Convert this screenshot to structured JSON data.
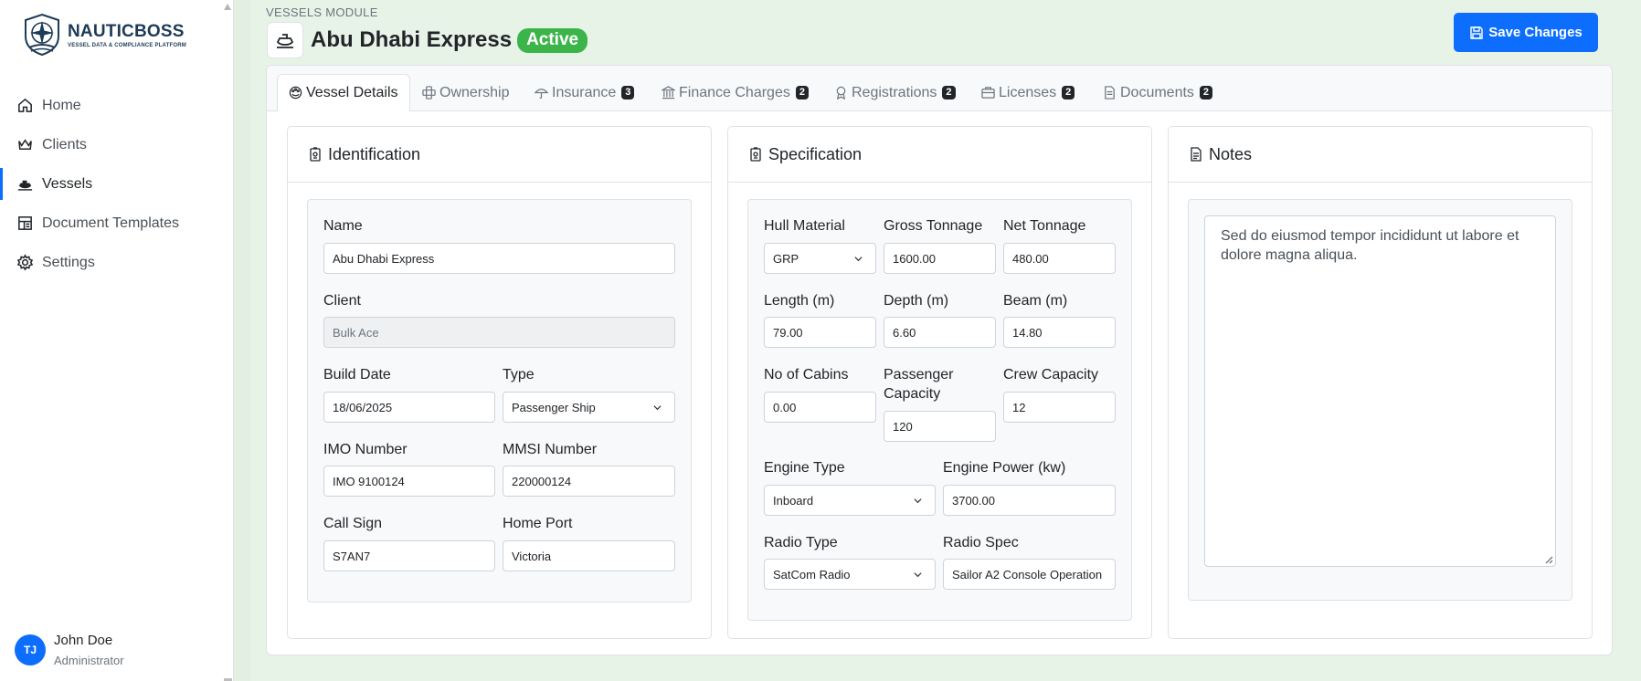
{
  "brand": {
    "name_part1": "NAUTIC",
    "name_part2": "BOSS",
    "tagline": "VESSEL DATA & COMPLIANCE PLATFORM"
  },
  "nav": {
    "items": [
      {
        "label": "Home",
        "icon": "home-icon"
      },
      {
        "label": "Clients",
        "icon": "crown-icon"
      },
      {
        "label": "Vessels",
        "icon": "ship-icon"
      },
      {
        "label": "Document Templates",
        "icon": "template-icon"
      },
      {
        "label": "Settings",
        "icon": "gear-icon"
      }
    ],
    "active": "Vessels"
  },
  "user": {
    "initials": "TJ",
    "name": "John Doe",
    "role": "Administrator"
  },
  "header": {
    "module": "VESSELS MODULE",
    "title": "Abu Dhabi Express",
    "status": "Active",
    "save_label": "Save Changes"
  },
  "tabs": [
    {
      "label": "Vessel Details",
      "icon": "palette-icon",
      "count": ""
    },
    {
      "label": "Ownership",
      "icon": "lifeline-icon",
      "count": ""
    },
    {
      "label": "Insurance",
      "icon": "umbrella-icon",
      "count": "3"
    },
    {
      "label": "Finance Charges",
      "icon": "bank-icon",
      "count": "2"
    },
    {
      "label": "Registrations",
      "icon": "award-icon",
      "count": "2"
    },
    {
      "label": "Licenses",
      "icon": "briefcase-icon",
      "count": "2"
    },
    {
      "label": "Documents",
      "icon": "file-icon",
      "count": "2"
    }
  ],
  "identification": {
    "title": "Identification",
    "name_label": "Name",
    "name_value": "Abu Dhabi Express",
    "client_label": "Client",
    "client_value": "Bulk Ace",
    "build_date_label": "Build Date",
    "build_date_value": "18/06/2025",
    "type_label": "Type",
    "type_value": "Passenger Ship",
    "imo_label": "IMO Number",
    "imo_value": "IMO 9100124",
    "mmsi_label": "MMSI Number",
    "mmsi_value": "220000124",
    "call_sign_label": "Call Sign",
    "call_sign_value": "S7AN7",
    "home_port_label": "Home Port",
    "home_port_value": "Victoria"
  },
  "specification": {
    "title": "Specification",
    "hull_label": "Hull Material",
    "hull_value": "GRP",
    "gross_label": "Gross Tonnage",
    "gross_value": "1600.00",
    "net_label": "Net Tonnage",
    "net_value": "480.00",
    "length_label": "Length (m)",
    "length_value": "79.00",
    "depth_label": "Depth (m)",
    "depth_value": "6.60",
    "beam_label": "Beam (m)",
    "beam_value": "14.80",
    "cabins_label": "No of Cabins",
    "cabins_value": "0.00",
    "passenger_label_1": "Passenger",
    "passenger_label_2": "Capacity",
    "passenger_value": "120",
    "crew_label": "Crew Capacity",
    "crew_value": "12",
    "engine_type_label": "Engine Type",
    "engine_type_value": "Inboard",
    "engine_power_label": "Engine Power (kw)",
    "engine_power_value": "3700.00",
    "radio_type_label": "Radio Type",
    "radio_type_value": "SatCom Radio",
    "radio_spec_label": "Radio Spec",
    "radio_spec_value": "Sailor A2 Console Operation"
  },
  "notes": {
    "title": "Notes",
    "text": "Sed do eiusmod tempor incididunt ut labore et dolore magna aliqua."
  },
  "colors": {
    "primary": "#0d6efd",
    "success": "#3bb54a",
    "background": "#e8f3e8",
    "brand": "#1d3b57"
  }
}
